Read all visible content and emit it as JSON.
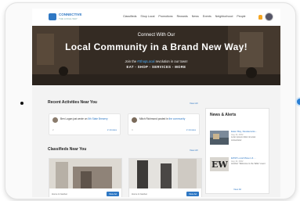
{
  "header": {
    "logo_name": "CONNECTIVE",
    "logo_sub": "THE LOCAL WAY",
    "nav": [
      "Classifieds",
      "Shop Local",
      "Promotions",
      "Rewards",
      "News",
      "Events",
      "Neighborhood",
      "People"
    ]
  },
  "hero": {
    "kicker": "Connect With Our",
    "title": "Local Community in a Brand New Way!",
    "line1_pre": "Join the ",
    "line1_tag": "#ShopLocal",
    "line1_post": " revolution in our town!",
    "line2": "EAT - SHOP - SERVICES - MORE"
  },
  "recent": {
    "title": "Recent Activities Near You",
    "view_all": "View All",
    "items": [
      {
        "name": "Ben Logan",
        "verb": " just wrote on ",
        "target": "5th State Brewery",
        "meta": "2",
        "right": "2 minutes"
      },
      {
        "name": "Mitch Richmond",
        "verb": " posted in ",
        "target": "the community",
        "meta": "4",
        "right": "2 minutes"
      }
    ]
  },
  "classifieds": {
    "title": "Classifieds Near You",
    "view_all": "View All",
    "items": [
      {
        "caption": "Home & Garden",
        "button": "View Ad"
      },
      {
        "caption": "Home & Garden",
        "button": "View Ad"
      }
    ]
  },
  "news": {
    "title": "News & Alerts",
    "items": [
      {
        "title": "Eater Bay, Restaurants...",
        "date": "Aug 12, 2022",
        "desc": "Lorem ipsum dolor sit amet consectetur"
      },
      {
        "title": "EWW Local Maven & ...",
        "date": "Aug 12, 2022",
        "desc": "Another \"Welcome to the Table\" event"
      }
    ],
    "view_all": "View All"
  }
}
